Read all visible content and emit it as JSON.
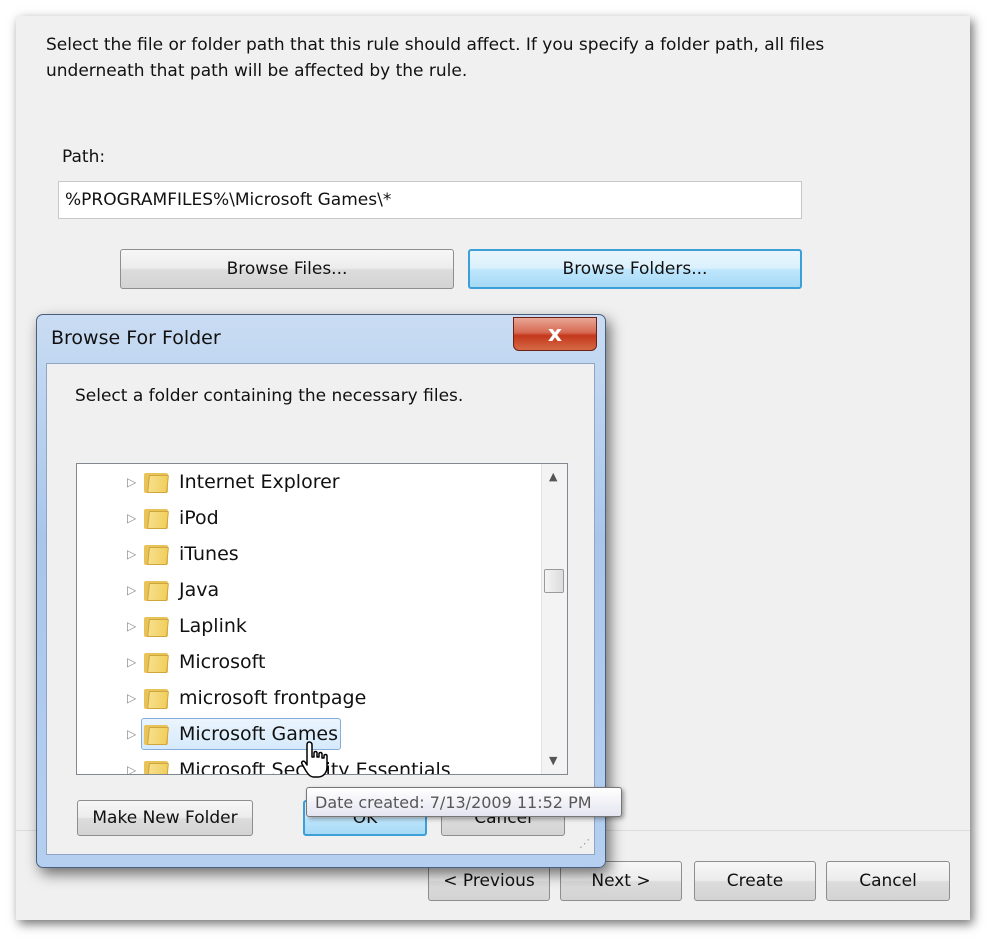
{
  "wizard": {
    "instructions": "Select the file or folder path that this rule should affect. If you specify a folder path, all files underneath that path will be affected by the rule.",
    "path_label": "Path:",
    "path_value": "%PROGRAMFILES%\\Microsoft Games\\*",
    "browse_files_label": "Browse Files...",
    "browse_folders_label": "Browse Folders...",
    "previous_label": "< Previous",
    "next_label": "Next >",
    "create_label": "Create",
    "cancel_label": "Cancel"
  },
  "dialog": {
    "title": "Browse For Folder",
    "close_glyph": "x",
    "description": "Select a folder containing the necessary files.",
    "tree_items": [
      "Internet Explorer",
      "iPod",
      "iTunes",
      "Java",
      "Laplink",
      "Microsoft",
      "microsoft frontpage",
      "Microsoft Games",
      "Microsoft Security Essentials"
    ],
    "selected_item": "Microsoft Games",
    "make_new_folder_label": "Make New Folder",
    "ok_label": "OK",
    "cancel_label": "Cancel"
  },
  "tooltip": {
    "text": "Date created: 7/13/2009 11:52 PM"
  },
  "icons": {
    "expander": "triangle-right-icon",
    "folder": "folder-icon",
    "cursor": "hand-pointer-icon"
  }
}
